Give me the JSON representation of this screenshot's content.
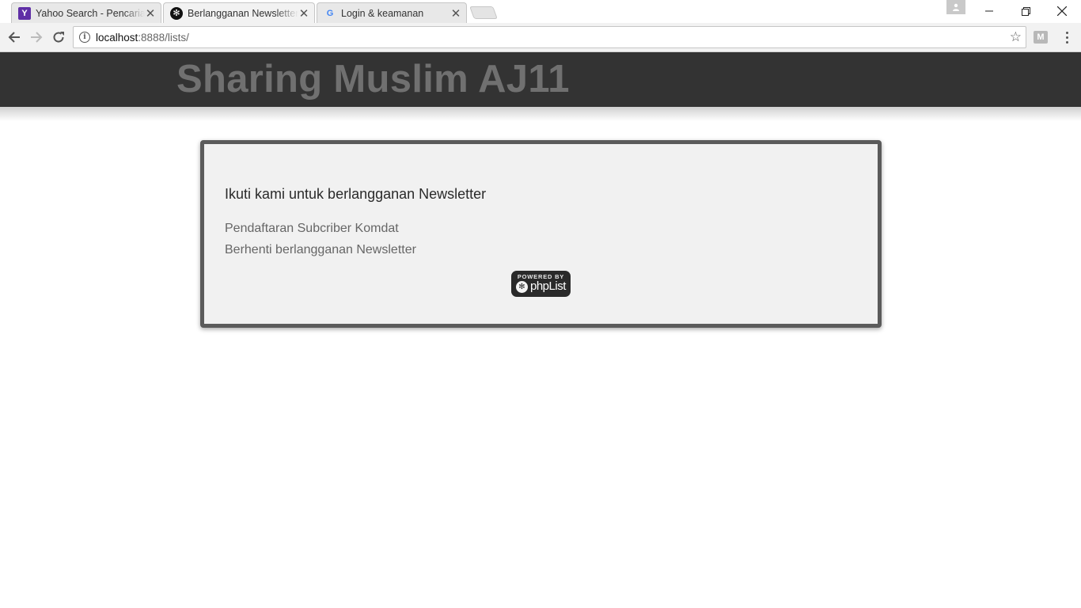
{
  "browser": {
    "tabs": [
      {
        "title": "Yahoo Search - Pencarian",
        "favicon": "yahoo-icon",
        "active": false
      },
      {
        "title": "Berlangganan Newsletter",
        "favicon": "phplist-icon",
        "active": true
      },
      {
        "title": "Login & keamanan",
        "favicon": "google-icon",
        "active": false
      }
    ],
    "url_host": "localhost",
    "url_rest": ":8888/lists/",
    "extension_label": "M"
  },
  "page": {
    "site_title": "Sharing Muslim AJ11",
    "heading": "Ikuti kami untuk berlangganan Newsletter",
    "links": [
      {
        "label": "Pendaftaran Subcriber Komdat"
      },
      {
        "label": "Berhenti berlangganan Newsletter"
      }
    ],
    "powered_by": {
      "top": "POWERED BY",
      "name": "phpList"
    }
  },
  "colors": {
    "header_bg": "#333333",
    "site_title": "#707070",
    "panel_bg": "#f1f1f1",
    "panel_border": "#5b5b5b"
  }
}
